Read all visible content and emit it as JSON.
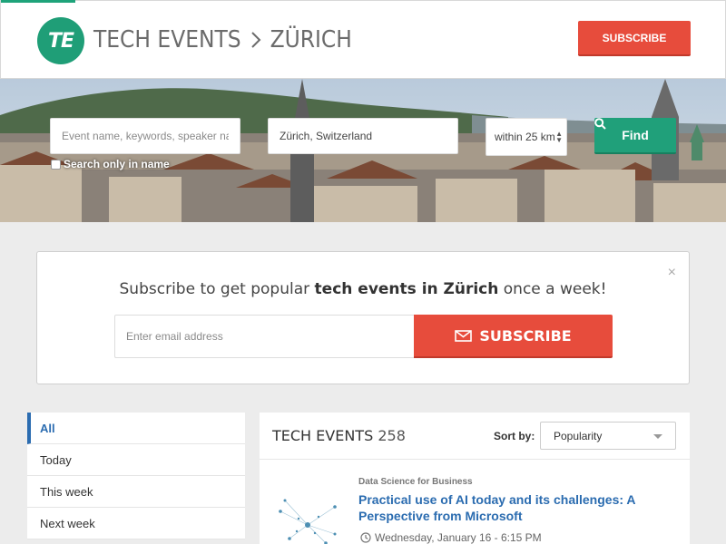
{
  "header": {
    "logo_text": "TE",
    "crumb_section": "TECH EVENTS",
    "crumb_city": "ZÜRICH",
    "subscribe_label": "SUBSCRIBE"
  },
  "search": {
    "keyword_placeholder": "Event name, keywords, speaker name",
    "location_value": "Zürich, Switzerland",
    "distance_value": "within 25 km",
    "find_label": "Find",
    "only_name_label": "Search only in name"
  },
  "subscribe_panel": {
    "title_pre": "Subscribe to get popular ",
    "title_bold": "tech events in Zürich",
    "title_post": " once a week!",
    "email_placeholder": "Enter email address",
    "button_label": "SUBSCRIBE",
    "close_symbol": "×"
  },
  "sidebar": {
    "items": [
      {
        "label": "All"
      },
      {
        "label": "Today"
      },
      {
        "label": "This week"
      },
      {
        "label": "Next week"
      }
    ]
  },
  "events": {
    "title": "TECH EVENTS",
    "count": "258",
    "sort_label": "Sort by:",
    "sort_value": "Popularity",
    "list": [
      {
        "category": "Data Science for Business",
        "title": "Practical use of AI today and its challenges: A Perspective from Microsoft",
        "when": "Wednesday, January 16 - 6:15 PM"
      }
    ]
  },
  "colors": {
    "brand_green": "#1f9e77",
    "subscribe_red": "#e74c3c",
    "link_blue": "#2b6cb0"
  }
}
